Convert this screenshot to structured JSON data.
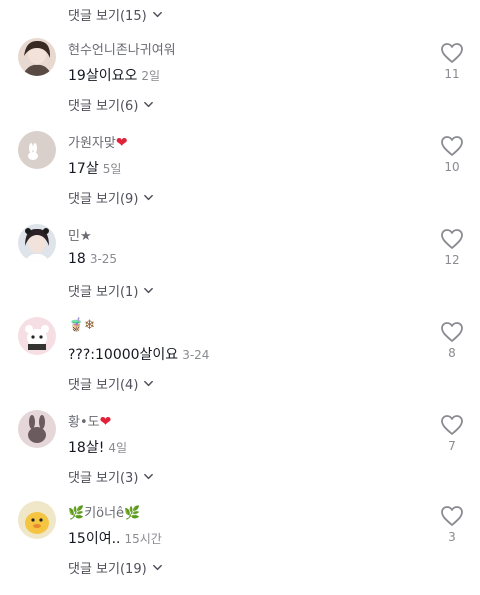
{
  "top_replies": {
    "label": "댓글 보기(15)"
  },
  "comments": [
    {
      "username": "현수언니존나귀여워",
      "username_emoji": "",
      "text": "19살이요오",
      "time": "2일",
      "likes": "11",
      "replies_label": "댓글 보기(6)"
    },
    {
      "username": "가원자맞",
      "username_emoji": "❤",
      "text": "17살",
      "time": "5일",
      "likes": "10",
      "replies_label": "댓글 보기(9)"
    },
    {
      "username": "민★",
      "username_emoji": "",
      "text": "18",
      "time": "3-25",
      "likes": "12",
      "replies_label": "댓글 보기(1)"
    },
    {
      "username": "",
      "username_emoji": "🧋❄",
      "text": "???:10000살이요",
      "time": "3-24",
      "likes": "8",
      "replies_label": "댓글 보기(4)"
    },
    {
      "username": "황•도",
      "username_emoji": "❤",
      "text": "18살!",
      "time": "4일",
      "likes": "7",
      "replies_label": "댓글 보기(3)"
    },
    {
      "username": "키ö너ê",
      "username_emoji": "🌿",
      "text": "15이여..",
      "time": "15시간",
      "likes": "3",
      "replies_label": "댓글 보기(19)"
    }
  ],
  "colors": {
    "heart_emoji": "#e0233a",
    "secondary_text": "#8a8b91"
  }
}
